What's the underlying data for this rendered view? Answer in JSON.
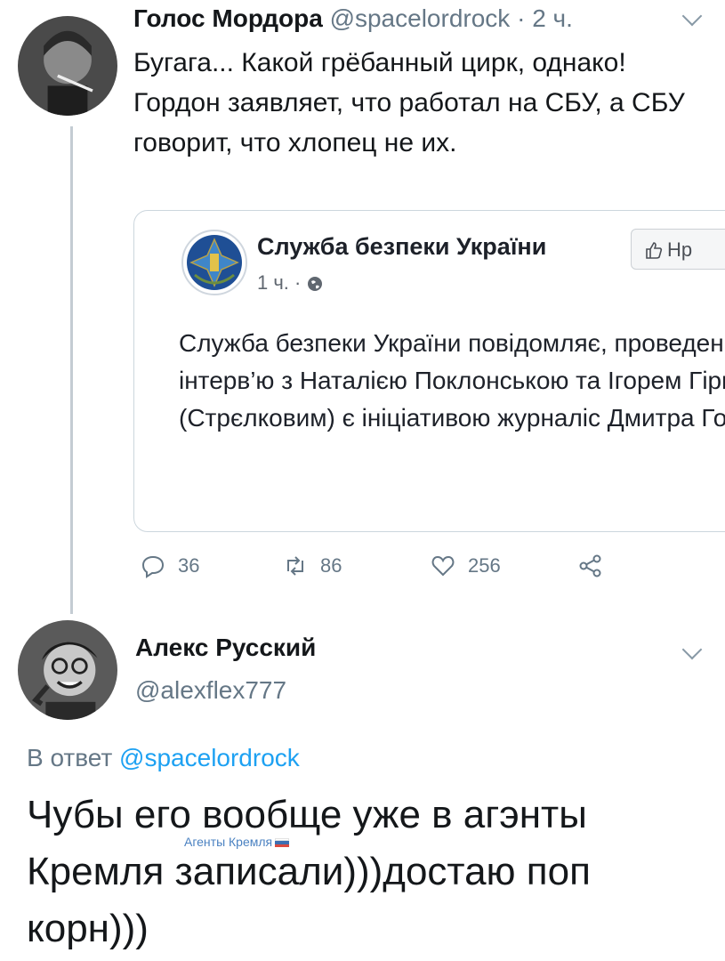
{
  "tweet1": {
    "name": "Голос Мордора",
    "handle": "@spacelordrock",
    "separator": "·",
    "time": "2 ч.",
    "text": "Бугага... Какой грёбанный цирк, однако! Гордон заявляет, что работал на СБУ, а СБУ говорит, что хлопец не их.",
    "quote": {
      "page_name": "Служба безпеки України",
      "time": "1 ч.",
      "separator": "·",
      "like_label": "Нр",
      "text": "Служба безпеки України повідомляє, проведення інтерв’ю з Наталією Поклонською та Ігорем Гіркіним (Стрєлковим) є ініціативою журналіс Дмитра Гордона."
    },
    "actions": {
      "replies": "36",
      "retweets": "86",
      "likes": "256"
    }
  },
  "tweet2": {
    "name": "Алекс Русский",
    "handle": "@alexflex777",
    "reply_prefix": "В ответ",
    "reply_to": "@spacelordrock",
    "text": "Чубы его вообще уже в агэнты Кремля записали)))достаю поп корн)))"
  },
  "watermark": "Агенты Кремля",
  "colors": {
    "link": "#1da1f2",
    "secondary_text": "#657786",
    "thread_line": "#c4ccd3",
    "card_border": "#ccd6dd"
  }
}
